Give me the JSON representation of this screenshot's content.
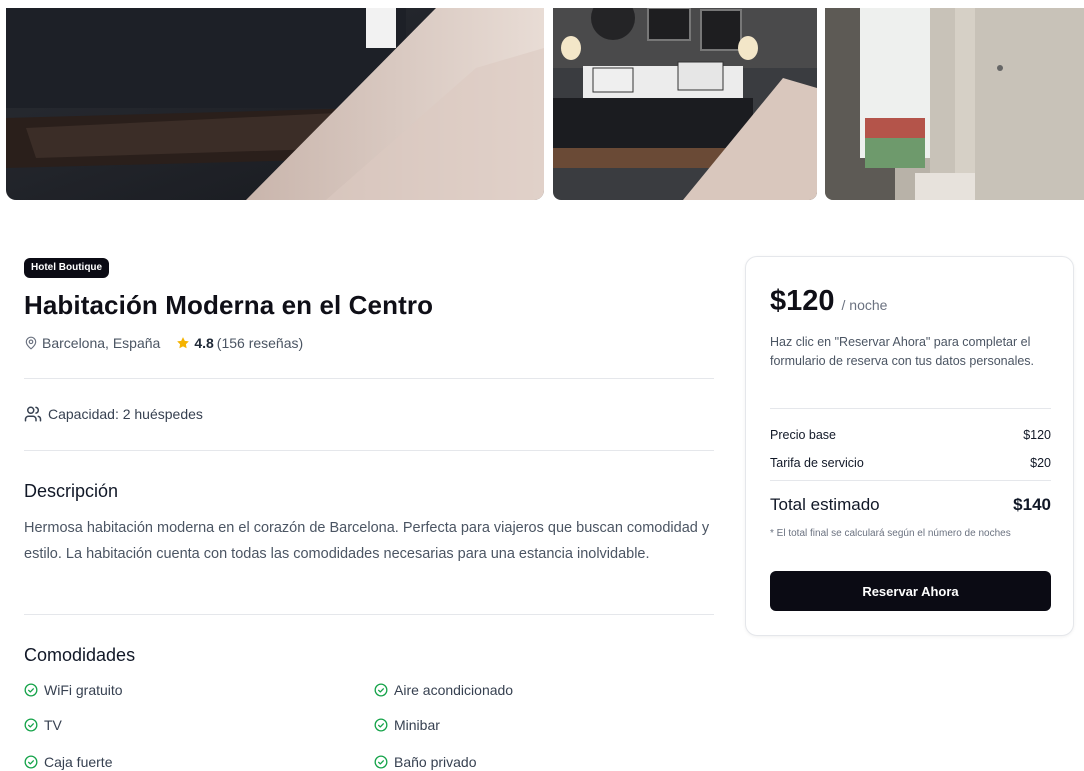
{
  "gallery": {
    "images": [
      {
        "icon": "hotel-room-photo-main"
      },
      {
        "icon": "hotel-room-photo-bedroom"
      },
      {
        "icon": "hotel-room-photo-window"
      }
    ]
  },
  "listing": {
    "badge": "Hotel Boutique",
    "title": "Habitación Moderna en el Centro",
    "location": "Barcelona, España",
    "rating": "4.8",
    "reviews": "(156 reseñas)",
    "capacity": "Capacidad: 2 huéspedes"
  },
  "description": {
    "heading": "Descripción",
    "text": "Hermosa habitación moderna en el corazón de Barcelona. Perfecta para viajeros que buscan comodidad y estilo. La habitación cuenta con todas las comodidades necesarias para una estancia inolvidable."
  },
  "amenities": {
    "heading": "Comodidades",
    "items": [
      {
        "label": "WiFi gratuito"
      },
      {
        "label": "Aire acondicionado"
      },
      {
        "label": "TV"
      },
      {
        "label": "Minibar"
      },
      {
        "label": "Caja fuerte"
      },
      {
        "label": "Baño privado"
      }
    ]
  },
  "booking": {
    "price": "$120",
    "per_night": "/ noche",
    "hint": "Haz clic en \"Reservar Ahora\" para completar el formulario de reserva con tus datos personales.",
    "base_label": "Precio base",
    "base_value": "$120",
    "fee_label": "Tarifa de servicio",
    "fee_value": "$20",
    "total_label": "Total estimado",
    "total_value": "$140",
    "note": "* El total final se calculará según el número de noches",
    "button": "Reservar Ahora"
  },
  "colors": {
    "primary": "#0b0b14",
    "star": "#f5b301",
    "check": "#16a34a",
    "divider": "#e5e7eb"
  }
}
